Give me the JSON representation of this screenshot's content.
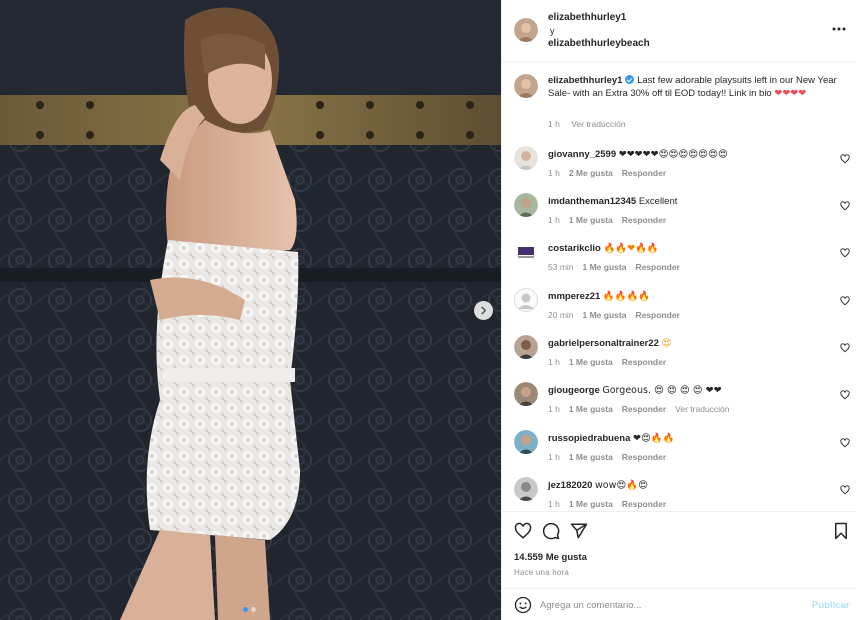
{
  "header": {
    "user1": "elizabethhurley1",
    "separator": "y",
    "user2": "elizabethhurleybeach"
  },
  "caption": {
    "username": "elizabethhurley1",
    "text": "Last few adorable playsuits left in our New Year Sale- with an Extra 30% off til EOD today!! Link in bio",
    "emojis": "❤❤❤❤",
    "time": "1 h",
    "translate": "Ver traducción"
  },
  "comments": [
    {
      "username": "giovanny_2599",
      "text": "❤❤❤❤❤😍😍😍😍😍😍😍",
      "time": "1 h",
      "likes": "2 Me gusta",
      "reply": "Responder",
      "translate": ""
    },
    {
      "username": "imdantheman12345",
      "text": "Excellent",
      "time": "1 h",
      "likes": "1 Me gusta",
      "reply": "Responder",
      "translate": ""
    },
    {
      "username": "costarikclio",
      "text": "🔥🔥❤🔥🔥",
      "time": "53 min",
      "likes": "1 Me gusta",
      "reply": "Responder",
      "translate": ""
    },
    {
      "username": "mmperez21",
      "text": "🔥🔥🔥🔥",
      "time": "20 min",
      "likes": "1 Me gusta",
      "reply": "Responder",
      "translate": ""
    },
    {
      "username": "gabrielpersonaltrainer22",
      "text": "😍",
      "time": "1 h",
      "likes": "1 Me gusta",
      "reply": "Responder",
      "translate": ""
    },
    {
      "username": "giougeorge",
      "text": "Gorgeous. 😍 😍 😍 😍 ❤❤",
      "time": "1 h",
      "likes": "1 Me gusta",
      "reply": "Responder",
      "translate": "Ver traducción"
    },
    {
      "username": "russopiedrabuena",
      "text": "❤😍🔥🔥",
      "time": "1 h",
      "likes": "1 Me gusta",
      "reply": "Responder",
      "translate": ""
    },
    {
      "username": "jez182020",
      "text": "wow😍🔥😍",
      "time": "1 h",
      "likes": "1 Me gusta",
      "reply": "Responder",
      "translate": ""
    }
  ],
  "actions": {
    "likes": "14.559 Me gusta",
    "time": "Hace una hora"
  },
  "add_comment": {
    "placeholder": "Agrega un comentario...",
    "post_label": "Publicar"
  },
  "icons": {
    "like": "heart-icon",
    "comment": "comment-icon",
    "share": "share-icon",
    "save": "bookmark-icon",
    "more": "more-icon",
    "emoji": "emoji-icon",
    "next": "chevron-right-icon"
  },
  "colors": {
    "accent": "#3897f0",
    "heart": "#ed4956",
    "muted": "#8e8e8e",
    "post_disabled": "#b2dffc"
  },
  "carousel": {
    "slides": 2,
    "active": 1
  }
}
